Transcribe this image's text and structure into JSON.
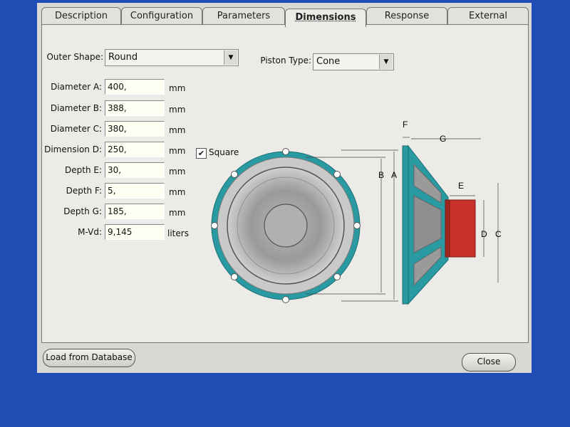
{
  "tabs": [
    {
      "label": "Description"
    },
    {
      "label": "Configuration"
    },
    {
      "label": "Parameters"
    },
    {
      "label": "Dimensions"
    },
    {
      "label": "Response"
    },
    {
      "label": "External"
    }
  ],
  "active_tab": "Dimensions",
  "outer_shape": {
    "label": "Outer Shape:",
    "value": "Round"
  },
  "piston_type": {
    "label": "Piston Type:",
    "value": "Cone"
  },
  "fields": [
    {
      "label": "Diameter A:",
      "value": "400,",
      "unit": "mm"
    },
    {
      "label": "Diameter B:",
      "value": "388,",
      "unit": "mm"
    },
    {
      "label": "Diameter C:",
      "value": "380,",
      "unit": "mm"
    },
    {
      "label": "Dimension D:",
      "value": "250,",
      "unit": "mm"
    },
    {
      "label": "Depth E:",
      "value": "30,",
      "unit": "mm"
    },
    {
      "label": "Depth F:",
      "value": "5,",
      "unit": "mm"
    },
    {
      "label": "Depth G:",
      "value": "185,",
      "unit": "mm"
    },
    {
      "label": "M-Vd:",
      "value": "9,145",
      "unit": "liters"
    }
  ],
  "square": {
    "label": "Square",
    "checked": true,
    "check_glyph": "✔"
  },
  "diagram_labels": {
    "A": "A",
    "B": "B",
    "C": "C",
    "D": "D",
    "E": "E",
    "F": "F",
    "G": "G"
  },
  "buttons": {
    "load": "Load from Database",
    "close": "Close"
  },
  "colors": {
    "frame": "#2a9aa2",
    "magnet": "#c8322a",
    "background": "#1f4db3"
  }
}
